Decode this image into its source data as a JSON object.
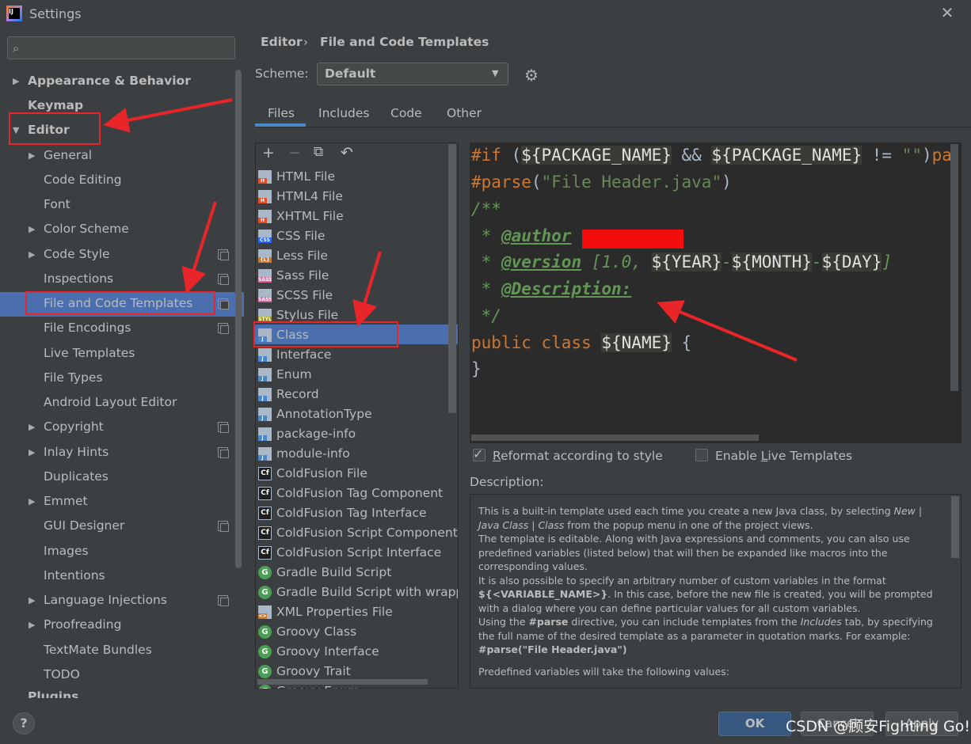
{
  "window": {
    "title": "Settings",
    "app_icon": "IJ"
  },
  "sidebar": {
    "search_placeholder": "",
    "items": [
      {
        "label": "Appearance & Behavior",
        "bold": true,
        "arrow": "right"
      },
      {
        "label": "Keymap",
        "bold": true
      },
      {
        "label": "Editor",
        "bold": true,
        "arrow": "down"
      },
      {
        "label": "General",
        "arrow": "right"
      },
      {
        "label": "Code Editing"
      },
      {
        "label": "Font"
      },
      {
        "label": "Color Scheme",
        "arrow": "right"
      },
      {
        "label": "Code Style",
        "arrow": "right",
        "project": true
      },
      {
        "label": "Inspections",
        "project": true
      },
      {
        "label": "File and Code Templates",
        "project": true,
        "selected": true
      },
      {
        "label": "File Encodings",
        "project": true
      },
      {
        "label": "Live Templates"
      },
      {
        "label": "File Types"
      },
      {
        "label": "Android Layout Editor"
      },
      {
        "label": "Copyright",
        "arrow": "right",
        "project": true
      },
      {
        "label": "Inlay Hints",
        "arrow": "right",
        "project": true
      },
      {
        "label": "Duplicates"
      },
      {
        "label": "Emmet",
        "arrow": "right"
      },
      {
        "label": "GUI Designer",
        "project": true
      },
      {
        "label": "Images"
      },
      {
        "label": "Intentions"
      },
      {
        "label": "Language Injections",
        "arrow": "right",
        "project": true
      },
      {
        "label": "Proofreading",
        "arrow": "right"
      },
      {
        "label": "TextMate Bundles"
      },
      {
        "label": "TODO"
      },
      {
        "label": "Plugins",
        "bold": true
      }
    ]
  },
  "breadcrumb": {
    "section": "Editor",
    "separator": "›",
    "page": "File and Code Templates"
  },
  "scheme": {
    "label": "Scheme:",
    "value": "Default"
  },
  "tabs": [
    {
      "label": "Files",
      "active": true
    },
    {
      "label": "Includes"
    },
    {
      "label": "Code"
    },
    {
      "label": "Other"
    }
  ],
  "toolbar": {
    "add": "+",
    "remove": "−",
    "copy": "⧉",
    "reset": "↶"
  },
  "templates": [
    {
      "label": "HTML File",
      "icon": "html",
      "tag": "H"
    },
    {
      "label": "HTML4 File",
      "icon": "html",
      "tag": "H"
    },
    {
      "label": "XHTML File",
      "icon": "html",
      "tag": "H"
    },
    {
      "label": "CSS File",
      "icon": "css",
      "tag": "CSS"
    },
    {
      "label": "Less File",
      "icon": "less",
      "tag": "{L}"
    },
    {
      "label": "Sass File",
      "icon": "sass",
      "tag": "SASS"
    },
    {
      "label": "SCSS File",
      "icon": "sass",
      "tag": "SASS"
    },
    {
      "label": "Stylus File",
      "icon": "styl",
      "tag": "STYL"
    },
    {
      "label": "Class",
      "icon": "java",
      "tag": "J",
      "selected": true
    },
    {
      "label": "Interface",
      "icon": "java",
      "tag": "J"
    },
    {
      "label": "Enum",
      "icon": "java",
      "tag": "J"
    },
    {
      "label": "Record",
      "icon": "java",
      "tag": "J"
    },
    {
      "label": "AnnotationType",
      "icon": "java",
      "tag": "J"
    },
    {
      "label": "package-info",
      "icon": "java",
      "tag": "J"
    },
    {
      "label": "module-info",
      "icon": "java",
      "tag": "J"
    },
    {
      "label": "ColdFusion File",
      "icon": "cf",
      "tag": "Cf"
    },
    {
      "label": "ColdFusion Tag Component",
      "icon": "cf",
      "tag": "Cf"
    },
    {
      "label": "ColdFusion Tag Interface",
      "icon": "cf",
      "tag": "Cf"
    },
    {
      "label": "ColdFusion Script Component",
      "icon": "cf",
      "tag": "Cf"
    },
    {
      "label": "ColdFusion Script Interface",
      "icon": "cf",
      "tag": "Cf"
    },
    {
      "label": "Gradle Build Script",
      "icon": "gradle",
      "tag": "G"
    },
    {
      "label": "Gradle Build Script with wrappe",
      "icon": "gradle",
      "tag": "G"
    },
    {
      "label": "XML Properties File",
      "icon": "xml",
      "tag": "<>"
    },
    {
      "label": "Groovy Class",
      "icon": "groovy",
      "tag": "G"
    },
    {
      "label": "Groovy Interface",
      "icon": "groovy",
      "tag": "G"
    },
    {
      "label": "Groovy Trait",
      "icon": "groovy",
      "tag": "G"
    },
    {
      "label": "Groovy Enum",
      "icon": "groovy",
      "tag": "G"
    }
  ],
  "editor": {
    "lines": [
      [
        [
          "k",
          "#if "
        ],
        [
          "p",
          "("
        ],
        [
          "v",
          "${PACKAGE_NAME}"
        ],
        [
          "p",
          " && "
        ],
        [
          "v",
          "${PACKAGE_NAME}"
        ],
        [
          "p",
          " != "
        ],
        [
          "s",
          "\"\""
        ],
        [
          "p",
          ")"
        ],
        [
          "k",
          "pa"
        ]
      ],
      [
        [
          "k",
          "#parse"
        ],
        [
          "p",
          "("
        ],
        [
          "s",
          "\"File Header.java\""
        ],
        [
          "p",
          ")"
        ]
      ],
      [
        [
          "c",
          "/**"
        ]
      ],
      [
        [
          "c",
          " * "
        ],
        [
          "ct",
          "@author"
        ],
        [
          "c",
          " "
        ]
      ],
      [
        [
          "c",
          " * "
        ],
        [
          "ct",
          "@version"
        ],
        [
          "c",
          " [1.0, "
        ],
        [
          "v",
          "${YEAR}"
        ],
        [
          "c",
          "-"
        ],
        [
          "v",
          "${MONTH}"
        ],
        [
          "c",
          "-"
        ],
        [
          "v",
          "${DAY}"
        ],
        [
          "c",
          "]"
        ]
      ],
      [
        [
          "c",
          " * "
        ],
        [
          "ct",
          "@Description:"
        ]
      ],
      [
        [
          "c",
          " */"
        ]
      ],
      [
        [
          "kw",
          "public class "
        ],
        [
          "v",
          "${NAME}"
        ],
        [
          "p",
          " {"
        ]
      ],
      [
        [
          "p",
          "}"
        ]
      ]
    ]
  },
  "options": {
    "reformat": {
      "label": "Reformat according to style",
      "checked": true
    },
    "live_templates": {
      "label": "Enable Live Templates",
      "checked": false
    }
  },
  "description": {
    "label": "Description:",
    "footer": "Predefined variables will take the following values:"
  },
  "buttons": {
    "help": "?",
    "ok": "OK",
    "cancel": "Cancel",
    "apply": "Apply"
  },
  "watermark": "CSDN @顾安Fighting Go!",
  "colors": {
    "selection": "#4b6eaf",
    "annotation": "#e8262a",
    "accent": "#4a88c7"
  }
}
